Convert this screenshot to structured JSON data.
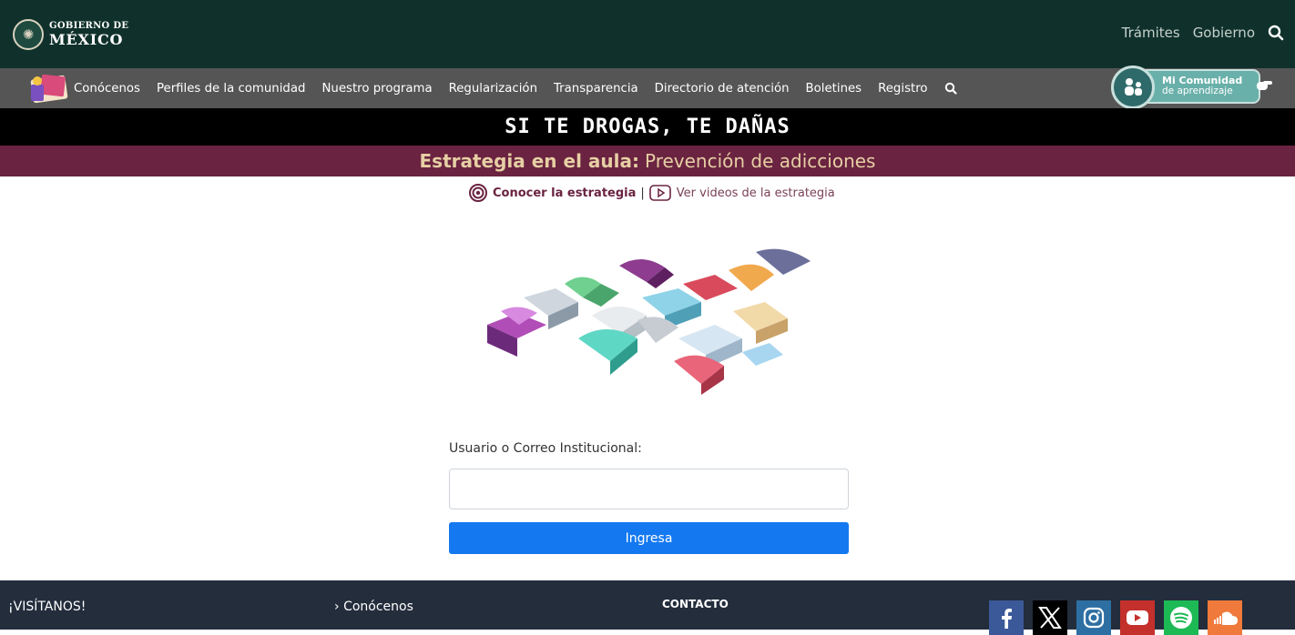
{
  "gov_header": {
    "logo_line1": "GOBIERNO DE",
    "logo_line2": "MÉXICO",
    "links": [
      "Trámites",
      "Gobierno"
    ]
  },
  "program_nav": {
    "items": [
      "Conócenos",
      "Perfiles de la comunidad",
      "Nuestro programa",
      "Regularización",
      "Transparencia",
      "Directorio de atención",
      "Boletines",
      "Registro"
    ],
    "community_line1": "Mi Comunidad",
    "community_line2": "de aprendizaje"
  },
  "campaign": {
    "slogan": "SI TE DROGAS, TE DAÑAS"
  },
  "strategy": {
    "title_bold": "Estrategia en el aula:",
    "title_normal": "Prevención de adicciones",
    "link_know": "Conocer la estrategia",
    "separator": "|",
    "link_videos": "Ver videos de la estrategia"
  },
  "login": {
    "label": "Usuario o Correo Institucional:",
    "input_value": "",
    "button_label": "Ingresa"
  },
  "footer": {
    "visit_title": "¡VISÍTANOS!",
    "link_conocenos": "Conócenos",
    "contact_title": "CONTACTO",
    "social": [
      "facebook",
      "x",
      "instagram",
      "youtube",
      "spotify",
      "soundcloud"
    ]
  },
  "colors": {
    "gov_green": "#10312b",
    "nav_gray": "#555555",
    "strategy_wine": "#6a2340",
    "strategy_text": "#e6cfa4",
    "button_blue": "#1479f0",
    "footer_navy": "#232d3c"
  }
}
